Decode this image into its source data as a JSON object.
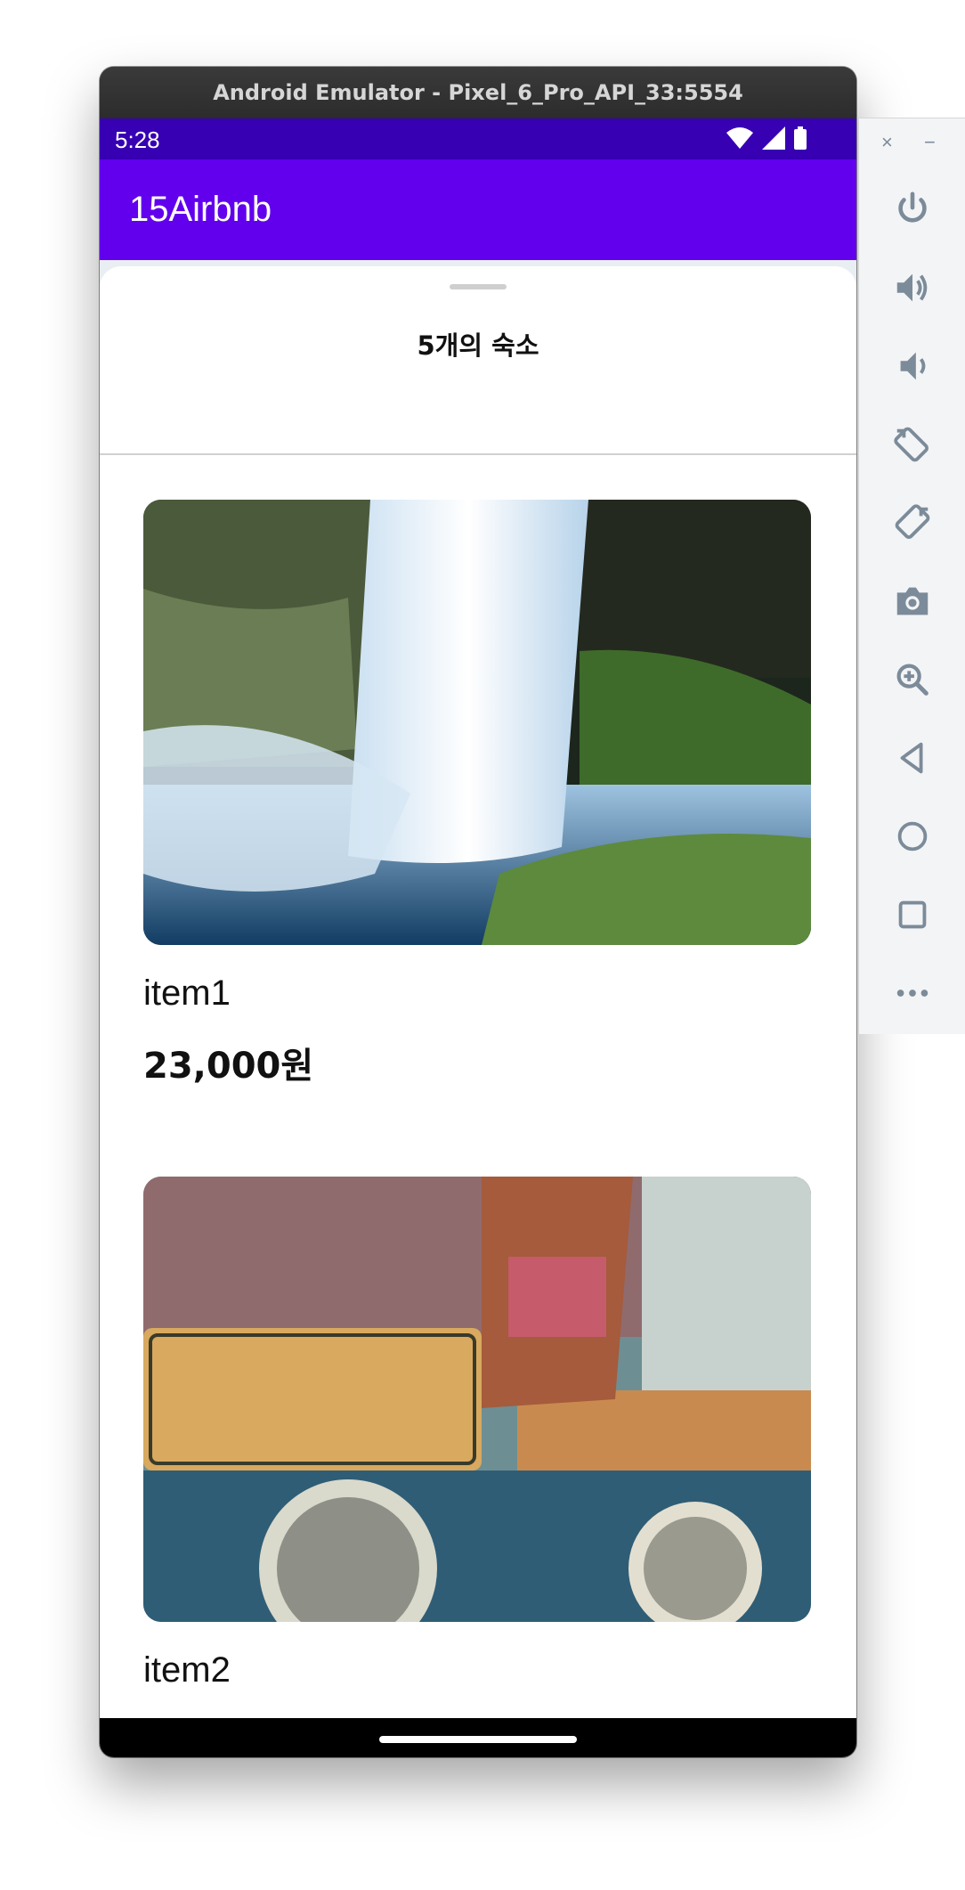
{
  "window": {
    "title": "Android Emulator - Pixel_6_Pro_API_33:5554"
  },
  "status_bar": {
    "time": "5:28"
  },
  "app_bar": {
    "title": "15Airbnb"
  },
  "sheet": {
    "title": "5개의 숙소"
  },
  "listings": [
    {
      "name": "item1",
      "price": "23,000원"
    },
    {
      "name": "item2"
    }
  ],
  "toolbar": {
    "close_glyph": "×",
    "minimize_glyph": "−",
    "buttons": [
      "power-icon",
      "volume-up-icon",
      "volume-down-icon",
      "rotate-left-icon",
      "rotate-right-icon",
      "camera-icon",
      "zoom-icon",
      "back-icon",
      "home-icon",
      "overview-icon",
      "more-icon"
    ]
  },
  "colors": {
    "status_bar": "#3700b3",
    "app_bar": "#6200ee",
    "toolbar_icon": "#7c8b99"
  }
}
